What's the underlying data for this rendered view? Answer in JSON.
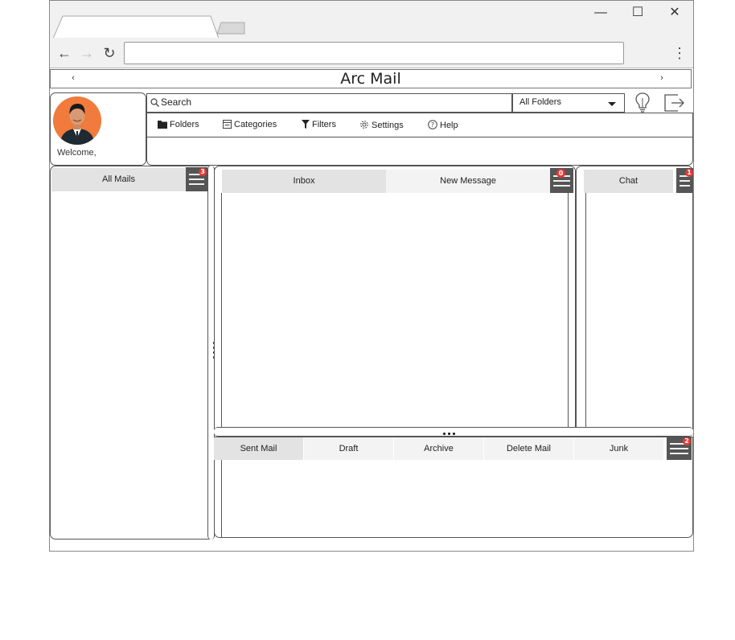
{
  "browser": {
    "window_controls": {
      "minimize": "—",
      "maximize": "☐",
      "close": "✕"
    },
    "nav": {
      "back": "←",
      "forward": "→",
      "reload": "↻",
      "menu": "⋮"
    },
    "address": ""
  },
  "app": {
    "title": "Arc Mail",
    "prev": "‹",
    "next": "›"
  },
  "profile": {
    "welcome": "Welcome,"
  },
  "search": {
    "placeholder": "Search",
    "folder_select": "All Folders"
  },
  "toolbar": {
    "items": [
      "Folders",
      "Categories",
      "Filters",
      "Settings",
      "Help"
    ]
  },
  "left_panel": {
    "tab": "All Mails",
    "badge": "3"
  },
  "center_panel": {
    "tabs": [
      "Inbox",
      "New Message"
    ],
    "badge": "0"
  },
  "right_panel": {
    "tab": "Chat",
    "badge": "1"
  },
  "bottom_panel": {
    "tabs": [
      "Sent Mail",
      "Draft",
      "Archive",
      "Delete Mail",
      "Junk"
    ],
    "badge": "2"
  },
  "colors": {
    "avatar_bg": "#f07b3c",
    "badge": "#e53935",
    "hamburger": "#555555"
  }
}
